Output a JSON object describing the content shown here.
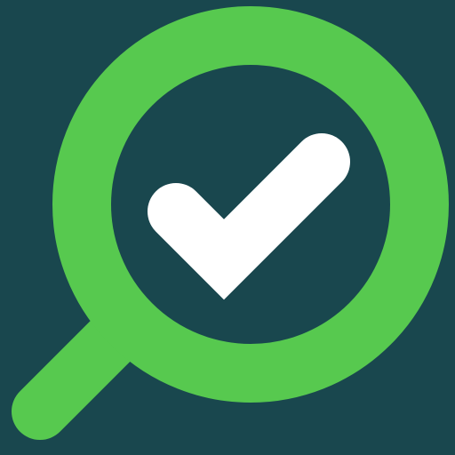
{
  "app": {
    "icon_name": "search-check-icon",
    "colors": {
      "background": "#19474E",
      "ring": "#57C94F",
      "handle": "#57C94F",
      "check": "#FFFFFF"
    }
  }
}
